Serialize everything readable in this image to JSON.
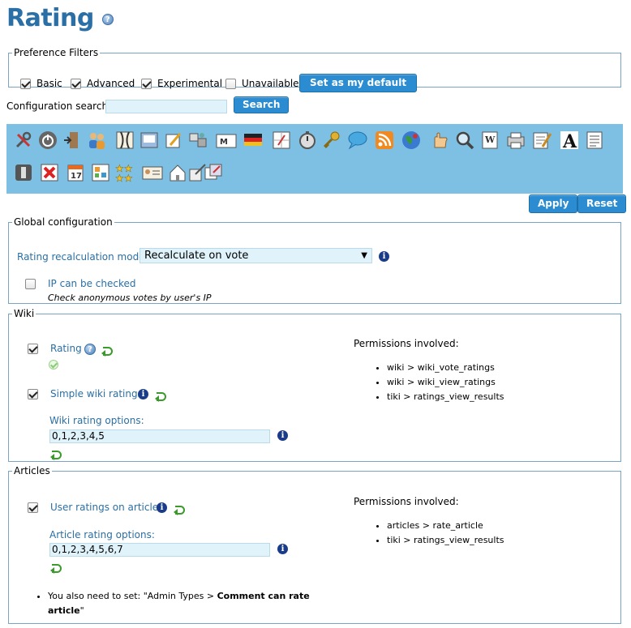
{
  "page": {
    "title": "Rating"
  },
  "filters": {
    "legend": "Preference Filters",
    "items": [
      {
        "label": "Basic",
        "checked": true
      },
      {
        "label": "Advanced",
        "checked": true
      },
      {
        "label": "Experimental",
        "checked": true
      },
      {
        "label": "Unavailable",
        "checked": false
      }
    ],
    "default_button": "Set as my default"
  },
  "search": {
    "label": "Configuration search:",
    "value": "",
    "button": "Search"
  },
  "toolbar": {
    "icons": [
      "tools-icon",
      "power-icon",
      "login-icon",
      "users-icon",
      "look-icon",
      "frame-icon",
      "edit-icon",
      "modules-icon",
      "messages-icon",
      "flag-icon",
      "compass-icon",
      "stopwatch-icon",
      "key-icon",
      "comment-icon",
      "rss-icon",
      "globe-icon",
      "hand-icon",
      "magnifier-icon",
      "text-area-icon",
      "printer-icon",
      "notepad-icon",
      "font-icon",
      "document-icon",
      "stop-icon",
      "delete-icon",
      "calendar-icon",
      "workspace-icon",
      "stars-icon",
      "profile-icon",
      "home-icon",
      "tracker-icon",
      "share-icon"
    ]
  },
  "actions": {
    "apply": "Apply",
    "reset": "Reset"
  },
  "global": {
    "legend": "Global configuration",
    "recalc_label": "Rating recalculation mode:",
    "recalc_value": "Recalculate on vote",
    "ip_label": "IP can be checked",
    "ip_checked": false,
    "ip_hint": "Check anonymous votes by user's IP"
  },
  "wiki": {
    "legend": "Wiki",
    "rating_label": "Rating",
    "rating_checked": true,
    "simple_label": "Simple wiki ratings",
    "simple_checked": true,
    "options_label": "Wiki rating options:",
    "options_value": "0,1,2,3,4,5",
    "permissions_title": "Permissions involved:",
    "permissions": [
      "wiki > wiki_vote_ratings",
      "wiki > wiki_view_ratings",
      "tiki > ratings_view_results"
    ]
  },
  "articles": {
    "legend": "Articles",
    "user_ratings_label": "User ratings on articles",
    "user_ratings_checked": true,
    "options_label": "Article rating options:",
    "options_value": "0,1,2,3,4,5,6,7",
    "permissions_title": "Permissions involved:",
    "permissions": [
      "articles > rate_article",
      "tiki > ratings_view_results"
    ],
    "note_prefix": "You also need to set: \"Admin Types > ",
    "note_bold": "Comment can rate article",
    "note_suffix": "\""
  }
}
